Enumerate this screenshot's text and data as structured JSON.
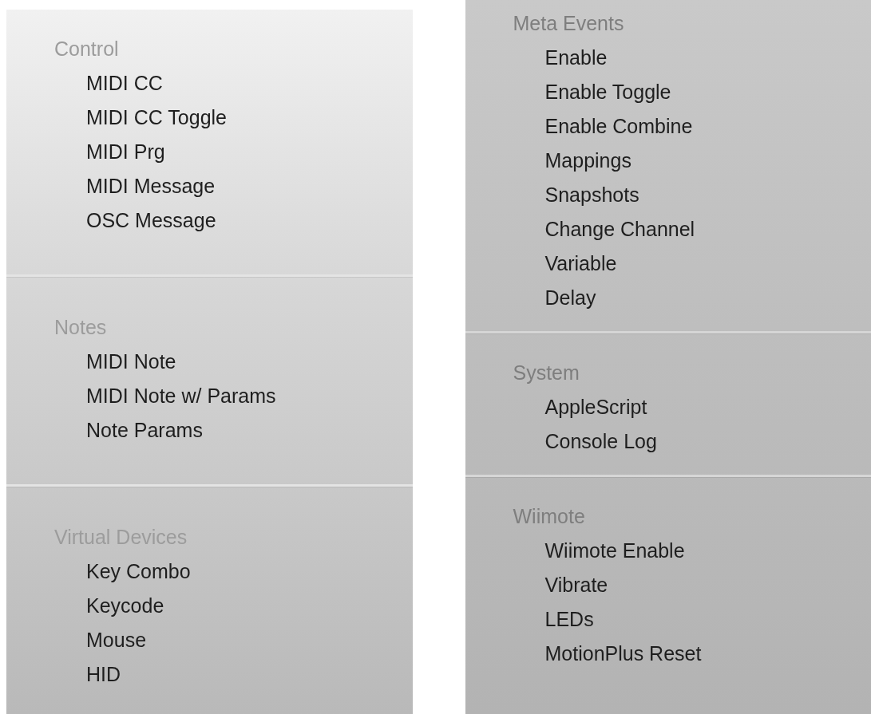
{
  "panels": [
    {
      "sections": [
        {
          "title": "Control",
          "items": [
            "MIDI CC",
            "MIDI CC Toggle",
            "MIDI Prg",
            "MIDI Message",
            "OSC Message"
          ]
        },
        {
          "title": "Notes",
          "items": [
            "MIDI Note",
            "MIDI Note w/ Params",
            "Note Params"
          ]
        },
        {
          "title": "Virtual Devices",
          "items": [
            "Key Combo",
            "Keycode",
            "Mouse",
            "HID"
          ]
        }
      ]
    },
    {
      "sections": [
        {
          "title": "Meta Events",
          "items": [
            "Enable",
            "Enable Toggle",
            "Enable Combine",
            "Mappings",
            "Snapshots",
            "Change Channel",
            "Variable",
            "Delay"
          ]
        },
        {
          "title": "System",
          "items": [
            "AppleScript",
            "Console Log"
          ]
        },
        {
          "title": "Wiimote",
          "items": [
            "Wiimote Enable",
            "Vibrate",
            "LEDs",
            "MotionPlus Reset"
          ]
        }
      ]
    }
  ]
}
